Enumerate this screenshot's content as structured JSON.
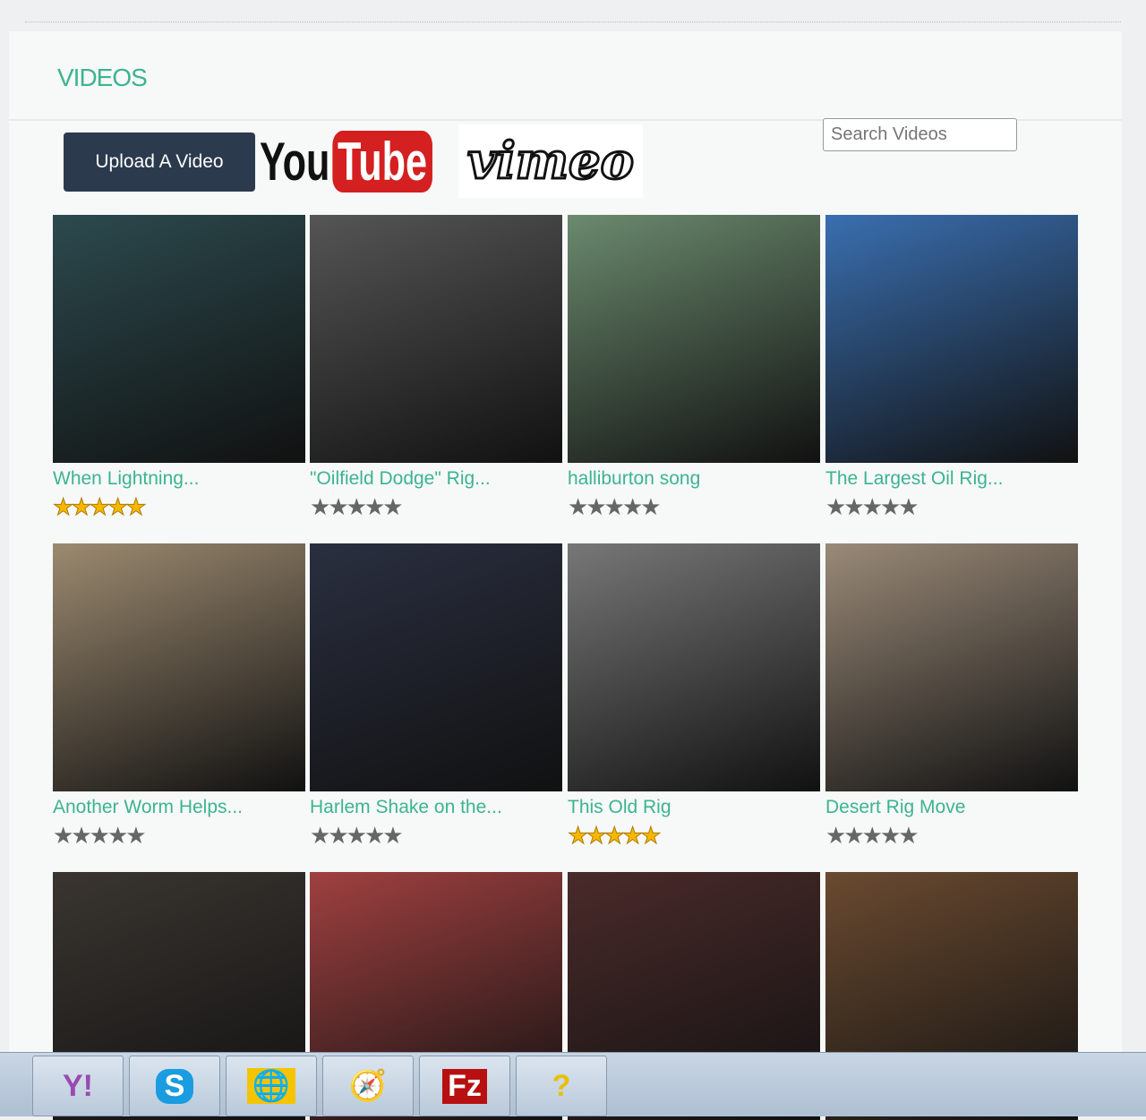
{
  "header": {
    "title": "VIDEOS"
  },
  "toolbar": {
    "upload_label": "Upload A Video",
    "youtube_you": "You",
    "youtube_tube": "Tube",
    "vimeo": "vimeo",
    "search_placeholder": "Search Videos"
  },
  "videos": [
    {
      "title": "When Lightning...",
      "rating": 5,
      "thumb": "#2c4a4e"
    },
    {
      "title": "\"Oilfield Dodge\" Rig...",
      "rating": 0,
      "thumb": "#555"
    },
    {
      "title": "halliburton song",
      "rating": 0,
      "thumb": "#6b8a6e"
    },
    {
      "title": "The Largest Oil Rig...",
      "rating": 0,
      "thumb": "#3a6fb0"
    },
    {
      "title": "Another Worm Helps...",
      "rating": 0,
      "thumb": "#9c8a70"
    },
    {
      "title": "Harlem Shake on the...",
      "rating": 0,
      "thumb": "#2a2f40"
    },
    {
      "title": "This Old Rig",
      "rating": 5,
      "thumb": "#777"
    },
    {
      "title": "Desert Rig Move",
      "rating": 0,
      "thumb": "#9a8a78"
    },
    {
      "thumb": "#3a3530"
    },
    {
      "thumb": "#a04040"
    },
    {
      "thumb": "#4a2a2a"
    },
    {
      "thumb": "#6a4a30"
    }
  ],
  "taskbar": [
    "yahoo-messenger",
    "skype",
    "network-checker",
    "safari",
    "filezilla",
    "help"
  ]
}
